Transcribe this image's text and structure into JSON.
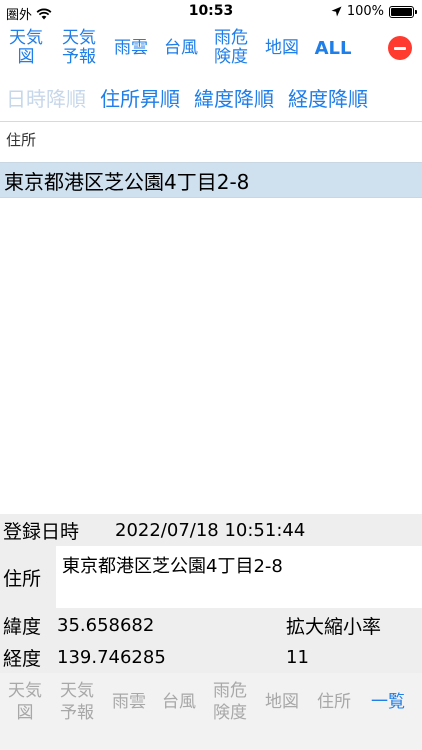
{
  "status_bar": {
    "carrier": "圏外",
    "time": "10:53",
    "battery": "100%"
  },
  "top_tabs": [
    "天気\n図",
    "天気\n予報",
    "雨雲",
    "台風",
    "雨危\n険度",
    "地図",
    "ALL"
  ],
  "sort_buttons": [
    "日時降順",
    "住所昇順",
    "緯度降順",
    "経度降順"
  ],
  "list": {
    "header": "住所",
    "rows": [
      "東京都港区芝公園4丁目2-8"
    ]
  },
  "details": {
    "registered_label": "登録日時",
    "registered_value": "2022/07/18 10:51:44",
    "address_label": "住所",
    "address_value": "東京都港区芝公園4丁目2-8",
    "latitude_label": "緯度",
    "latitude_value": "35.658682",
    "zoom_label": "拡大縮小率",
    "longitude_label": "経度",
    "longitude_value": "139.746285",
    "zoom_value": "11"
  },
  "bottom_tabs": [
    "天気\n図",
    "天気\n予報",
    "雨雲",
    "台風",
    "雨危\n険度",
    "地図",
    "住所",
    "一覧"
  ]
}
